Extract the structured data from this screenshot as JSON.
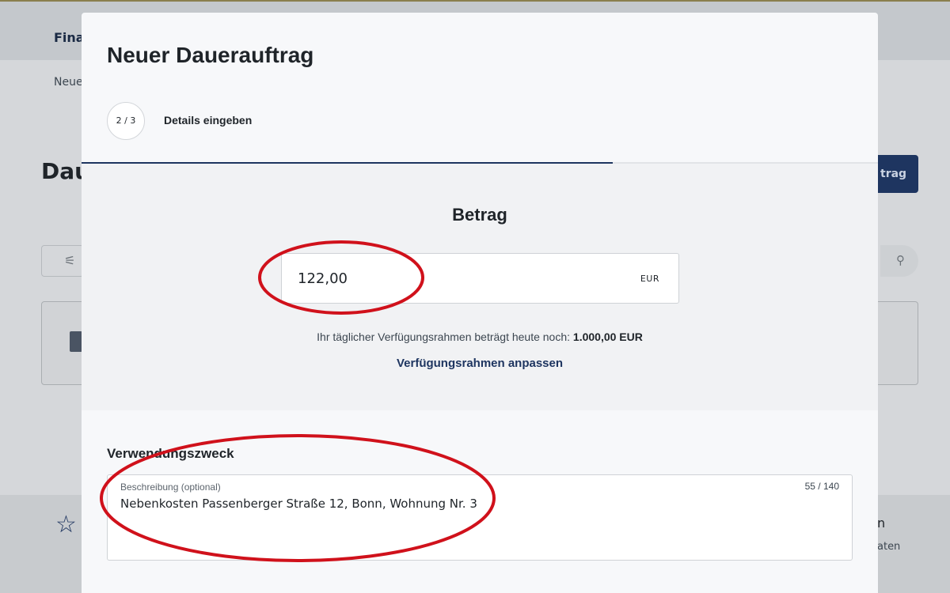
{
  "background": {
    "nav_text": "Fina",
    "breadcrumb": "Neue",
    "page_title": "Dau",
    "primary_button": "trag",
    "footer_right_title": "n",
    "footer_right_sub": "aten"
  },
  "modal": {
    "title": "Neuer Dauerauftrag",
    "step": {
      "indicator": "2 / 3",
      "label": "Details eingeben",
      "progress_fraction": 0.667
    },
    "amount": {
      "heading": "Betrag",
      "value": "122,00",
      "currency": "EUR",
      "limit_text": "Ihr täglicher Verfügungsrahmen beträgt heute noch:",
      "limit_value": "1.000,00 EUR",
      "limit_link": "Verfügungsrahmen anpassen"
    },
    "purpose": {
      "heading": "Verwendungszweck",
      "field_label": "Beschreibung (optional)",
      "counter": "55 / 140",
      "value": "Nebenkosten Passenberger Straße 12, Bonn, Wohnung Nr. 3"
    }
  },
  "colors": {
    "brand": "#1e3560",
    "annotation": "#d0111b"
  },
  "icons": {
    "filter": "filter-icon",
    "search": "search-icon",
    "star": "star-icon"
  }
}
